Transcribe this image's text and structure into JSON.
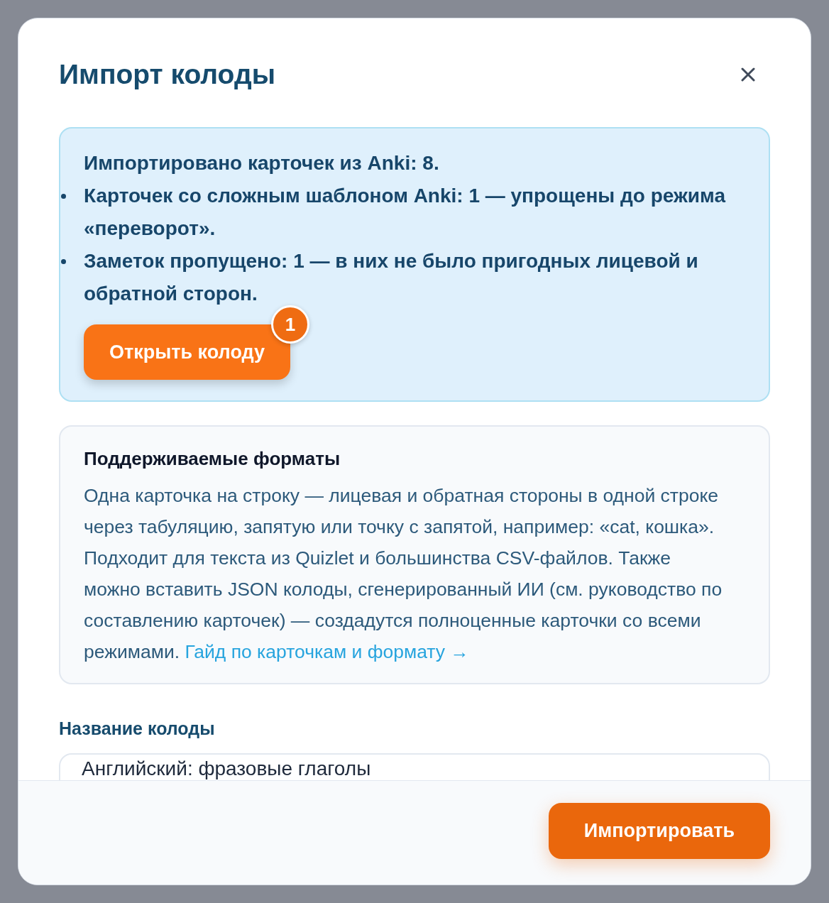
{
  "dialog": {
    "title": "Импорт колоды"
  },
  "import_result": {
    "summary": "Импортировано карточек из Anki: 8.",
    "notes": [
      "Карточек со сложным шаблоном Anki: 1 — упрощены до режима «переворот».",
      "Заметок пропущено: 1 — в них не было пригодных лицевой и обратной сторон."
    ],
    "open_button": {
      "label": "Открыть колоду",
      "badge": "1"
    }
  },
  "formats": {
    "title": "Поддерживаемые форматы",
    "text": "Одна карточка на строку — лицевая и обратная стороны в одной строке через табуляцию, запятую или точку с запятой, например: «cat, кошка». Подходит для текста из Quizlet и большинства CSV-файлов. Также можно вставить JSON колоды, сгенерированный ИИ (см. руководство по составлению карточек) — создадутся полноценные карточки со всеми режимами.",
    "link": "Гайд по карточкам и формату →"
  },
  "deck_name": {
    "label": "Название колоды",
    "value": "Английский: фразовые глаголы"
  },
  "footer": {
    "import_button": "Импортировать"
  }
}
